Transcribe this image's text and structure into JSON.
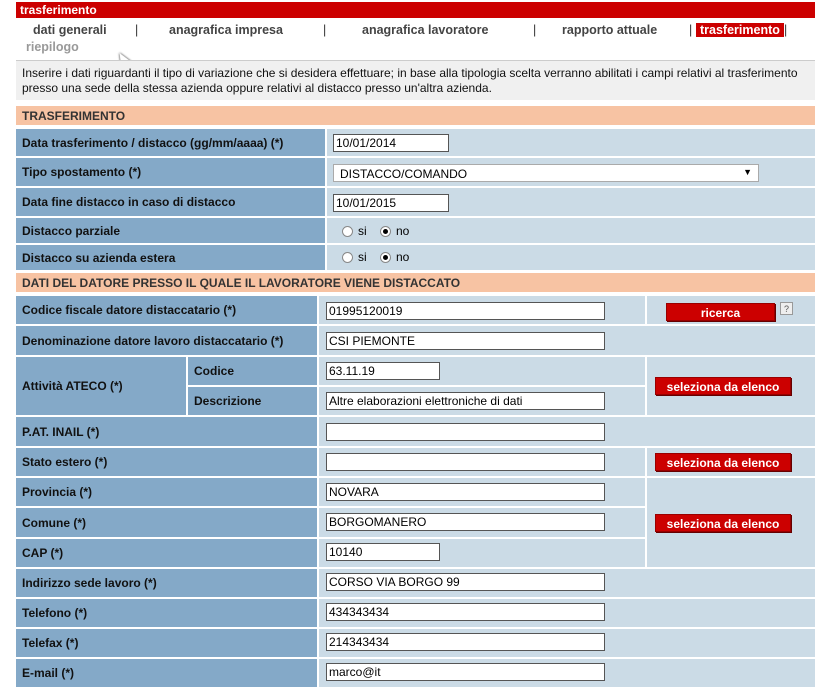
{
  "title": "trasferimento",
  "tabs": [
    {
      "label": "dati generali"
    },
    {
      "label": "anagrafica impresa"
    },
    {
      "label": "anagrafica lavoratore"
    },
    {
      "label": "rapporto attuale"
    },
    {
      "label": "trasferimento"
    },
    {
      "label": "riepilogo"
    }
  ],
  "separator": "|",
  "info_text": "Inserire i dati riguardanti il tipo di variazione che si desidera effettuare; in base alla tipologia scelta verranno abilitati i campi relativi al trasferimento presso una sede della stessa azienda oppure relativi al distacco presso un'altra azienda.",
  "section1": {
    "title": "TRASFERIMENTO",
    "data_trasferimento_label": "Data trasferimento / distacco (gg/mm/aaaa) (*)",
    "data_trasferimento_value": "10/01/2014",
    "tipo_spostamento_label": "Tipo spostamento (*)",
    "tipo_spostamento_value": "DISTACCO/COMANDO",
    "data_fine_label": "Data fine distacco in caso di distacco",
    "data_fine_value": "10/01/2015",
    "distacco_parziale_label": "Distacco parziale",
    "distacco_estera_label": "Distacco su azienda estera",
    "radio_si": "si",
    "radio_no": "no"
  },
  "section2": {
    "title": "DATI DEL DATORE PRESSO IL QUALE IL LAVORATORE VIENE DISTACCATO",
    "codice_fiscale_label": "Codice fiscale datore distaccatario (*)",
    "codice_fiscale_value": "01995120019",
    "ricerca_label": "ricerca",
    "help_label": "?",
    "denominazione_label": "Denominazione datore lavoro distaccatario (*)",
    "denominazione_value": "CSI PIEMONTE",
    "ateco_label": "Attività ATECO (*)",
    "codice_label": "Codice",
    "codice_value": "63.11.19",
    "descrizione_label": "Descrizione",
    "descrizione_value": "Altre elaborazioni elettroniche di dati",
    "seleziona_label": "seleziona da elenco",
    "pat_label": "P.AT. INAIL (*)",
    "pat_value": "",
    "stato_label": "Stato estero (*)",
    "stato_value": "",
    "provincia_label": "Provincia (*)",
    "provincia_value": "NOVARA",
    "comune_label": "Comune (*)",
    "comune_value": "BORGOMANERO",
    "cap_label": "CAP (*)",
    "cap_value": "10140",
    "indirizzo_label": "Indirizzo sede lavoro (*)",
    "indirizzo_value": "CORSO VIA BORGO 99",
    "telefono_label": "Telefono (*)",
    "telefono_value": "434343434",
    "telefax_label": "Telefax (*)",
    "telefax_value": "214343434",
    "email_label": "E-mail (*)",
    "email_value": "marco@it"
  }
}
